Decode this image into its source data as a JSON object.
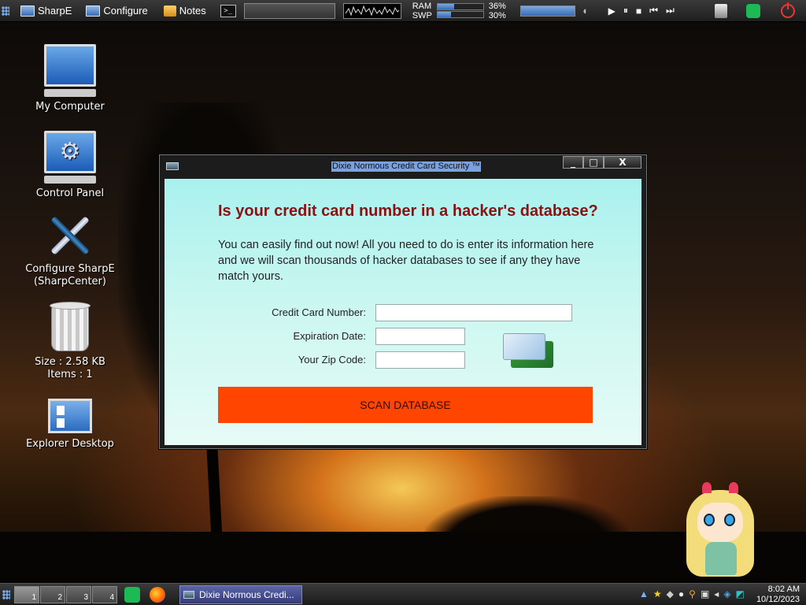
{
  "top_panel": {
    "sharpe_label": "SharpE",
    "configure_label": "Configure",
    "notes_label": "Notes",
    "terminal_glyph": ">_",
    "ram_label": "RAM",
    "ram_value": "36%",
    "ram_fraction": 0.36,
    "swp_label": "SWP",
    "swp_value": "30%",
    "swp_fraction": 0.3,
    "media": {
      "play": "▶",
      "pause": "⏸",
      "stop": "■",
      "prev": "⏮",
      "next": "⏭"
    }
  },
  "desktop_icons": {
    "my_computer": "My Computer",
    "control_panel": "Control Panel",
    "configure_sharpe_line1": "Configure SharpE",
    "configure_sharpe_line2": "(SharpCenter)",
    "trash_size": "Size : 2.58 KB",
    "trash_items": "Items : 1",
    "explorer_desktop": "Explorer Desktop"
  },
  "window": {
    "title": "Dixie Normous Credit Card Security ™",
    "min_glyph": "_",
    "max_glyph": "□",
    "close_glyph": "X",
    "headline": "Is your credit card number in a hacker's database?",
    "intro": "You can easily find out now! All you need to do is enter its information here and we will scan thousands of hacker databases to see if any they have match yours.",
    "form": {
      "card_number_label": "Credit Card Number:",
      "card_number_value": "",
      "expiration_label": "Expiration Date:",
      "expiration_value": "",
      "zip_label": "Your Zip Code:",
      "zip_value": ""
    },
    "scan_button": "SCAN DATABASE"
  },
  "taskbar": {
    "workspaces": [
      "1",
      "2",
      "3",
      "4"
    ],
    "task_label": "Dixie Normous Credi...",
    "clock_time": "8:02 AM",
    "clock_date": "10/12/2023"
  },
  "colors": {
    "headline": "#8a1212",
    "scan_button": "#ff4500",
    "window_body": "#bff4ef"
  }
}
